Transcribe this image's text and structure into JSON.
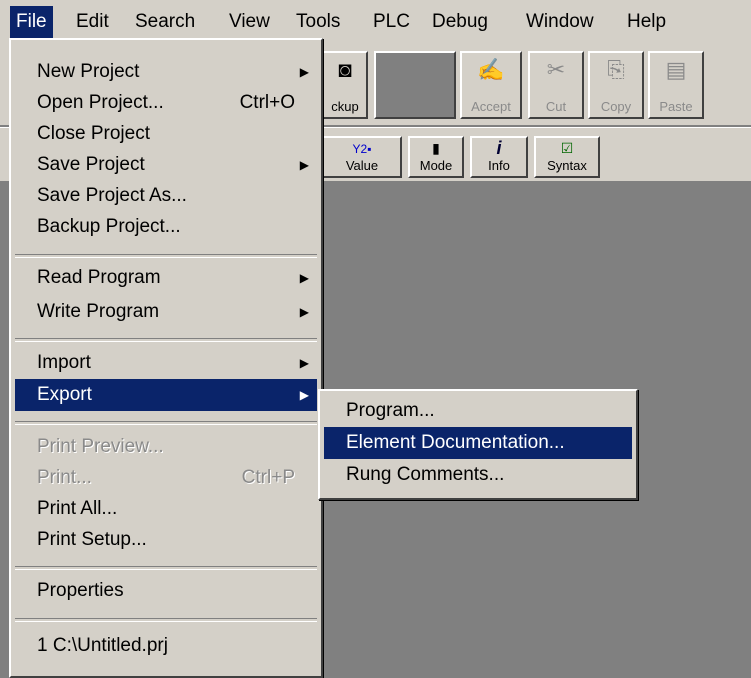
{
  "menubar": [
    "File",
    "Edit",
    "Search",
    "View",
    "Tools",
    "PLC",
    "Debug",
    "Window",
    "Help"
  ],
  "menubar_underline": [
    "F",
    "E",
    "S",
    "V",
    "T",
    "P",
    "D",
    "W",
    "H"
  ],
  "toolbar": {
    "row1": [
      {
        "label": "ckup",
        "icon": "◙",
        "state": "normal"
      },
      {
        "label": "",
        "icon": "",
        "state": "blank"
      },
      {
        "label": "Accept",
        "icon": "✍",
        "state": "disabled"
      },
      {
        "label": "Cut",
        "icon": "✂",
        "state": "disabled"
      },
      {
        "label": "Copy",
        "icon": "⎘",
        "state": "disabled"
      },
      {
        "label": "Paste",
        "icon": "▤",
        "state": "disabled"
      }
    ],
    "row2": [
      {
        "label": "Value",
        "icon": "Y2▪"
      },
      {
        "label": "Mode",
        "icon": "▮"
      },
      {
        "label": "Info",
        "icon": "i"
      },
      {
        "label": "Syntax",
        "icon": "☑"
      }
    ]
  },
  "file_menu": {
    "items": [
      {
        "label": "New Project",
        "shortcut": "",
        "submenu": true
      },
      {
        "label": "Open Project...",
        "shortcut": "Ctrl+O",
        "submenu": false
      },
      {
        "label": "Close Project",
        "shortcut": "",
        "submenu": false
      },
      {
        "label": "Save Project",
        "shortcut": "",
        "submenu": true
      },
      {
        "label": "Save Project As...",
        "shortcut": "",
        "submenu": false
      },
      {
        "label": "Backup Project...",
        "shortcut": "",
        "submenu": false
      },
      {
        "label": "Read Program",
        "shortcut": "",
        "submenu": true
      },
      {
        "label": "Write Program",
        "shortcut": "",
        "submenu": true
      },
      {
        "label": "Import",
        "shortcut": "",
        "submenu": true
      },
      {
        "label": "Export",
        "shortcut": "",
        "submenu": true
      },
      {
        "label": "Print Preview...",
        "shortcut": "",
        "submenu": false
      },
      {
        "label": "Print...",
        "shortcut": "Ctrl+P",
        "submenu": false
      },
      {
        "label": "Print All...",
        "shortcut": "",
        "submenu": false
      },
      {
        "label": "Print Setup...",
        "shortcut": "",
        "submenu": false
      },
      {
        "label": "Properties",
        "shortcut": "",
        "submenu": false
      },
      {
        "label": "1 C:\\Untitled.prj",
        "shortcut": "",
        "submenu": false
      }
    ]
  },
  "export_submenu": {
    "items": [
      "Program...",
      "Element Documentation...",
      "Rung Comments..."
    ]
  },
  "colors": {
    "menu_bg": "#d4d0c8",
    "highlight": "#0a246a",
    "workspace": "#808080",
    "disabled": "#8a8a8a"
  }
}
